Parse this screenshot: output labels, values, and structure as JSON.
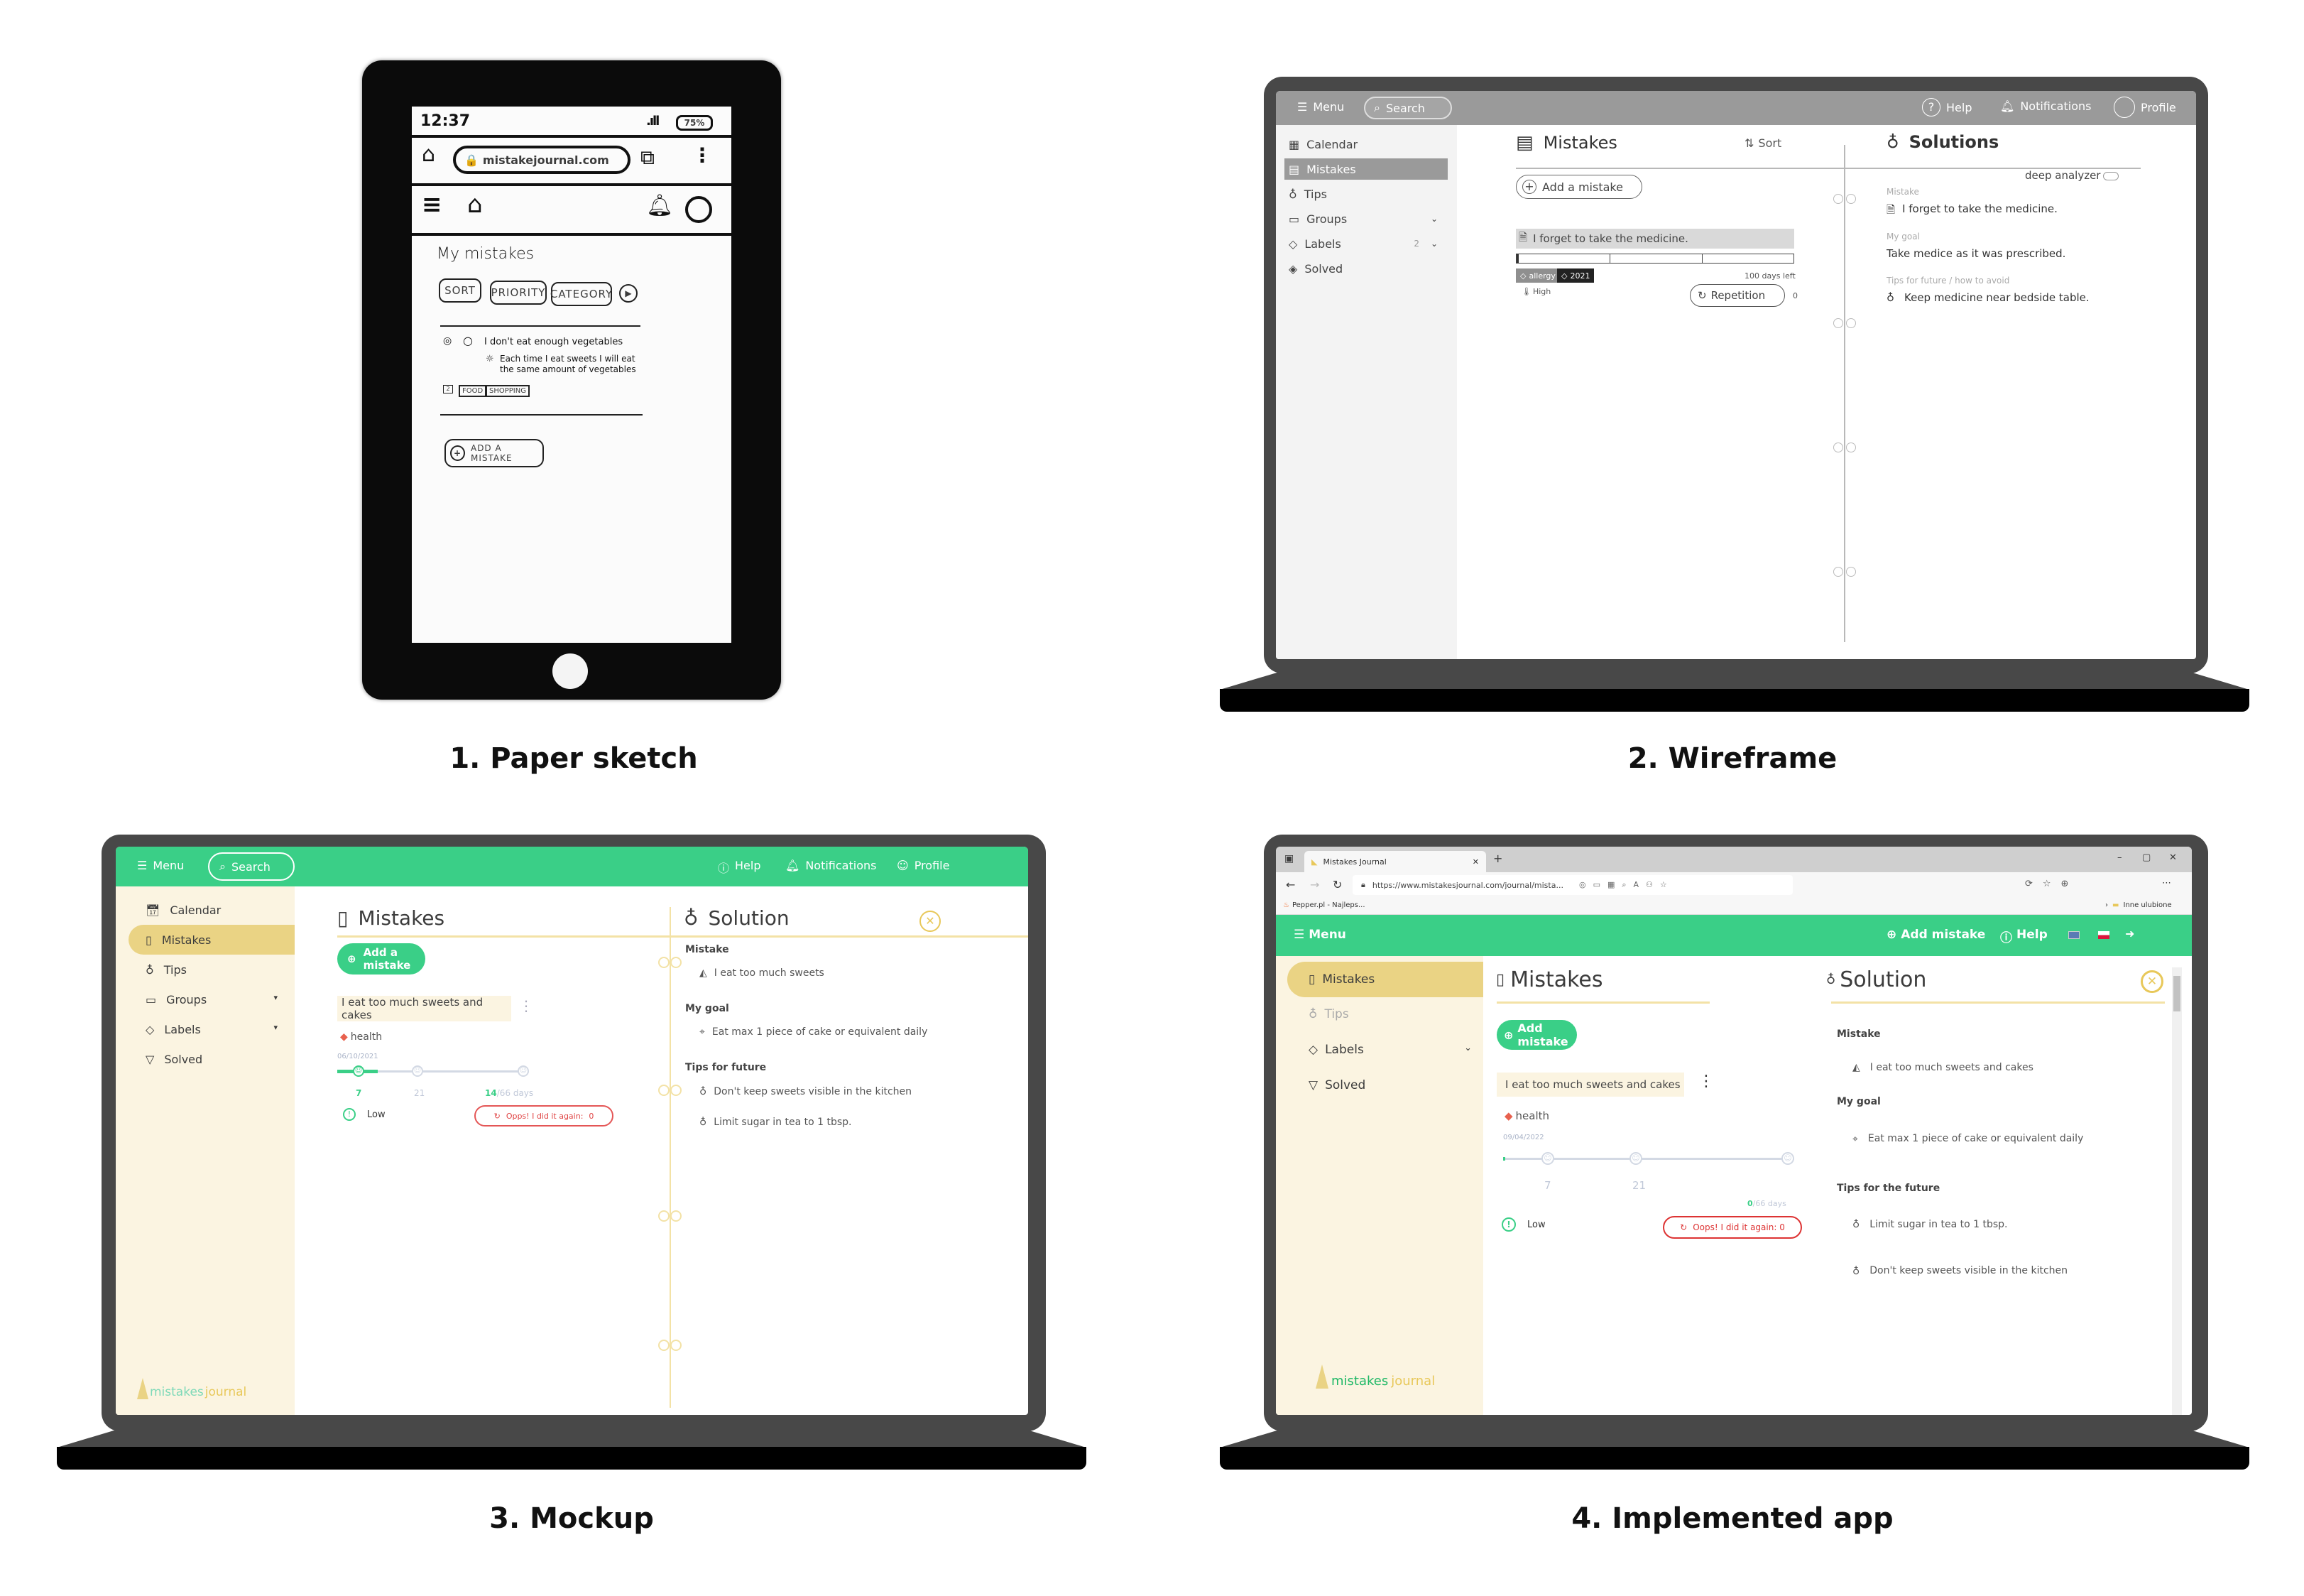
{
  "captions": {
    "sketch": "1. Paper sketch",
    "wireframe": "2. Wireframe",
    "mockup": "3. Mockup",
    "implemented": "4. Implemented app"
  },
  "colors": {
    "brand_green": "#3acf87",
    "cream": "#fbf4e1",
    "gold": "#e8c85a",
    "active_gold": "#ead384",
    "danger_red": "#e45656",
    "wireframe_gray": "#9a9a9a",
    "laptop": "#484848"
  },
  "sketch": {
    "time": "12:37",
    "battery": "75%",
    "url": "mistakejournal.com",
    "heading": "My mistakes",
    "filters": [
      "SORT",
      "PRIORITY",
      "CATEGORY"
    ],
    "mistake": "I don't eat enough vegetables",
    "tip": "Each time I eat sweets I will eat the same amount of vegetables",
    "priority_badge": "2",
    "tags": [
      "FOOD",
      "SHOPPING"
    ],
    "add_button": "ADD A MISTAKE"
  },
  "wireframe": {
    "topbar": {
      "menu": "Menu",
      "search": "Search",
      "help": "Help",
      "notifications": "Notifications",
      "profile": "Profile"
    },
    "sidebar": [
      {
        "label": "Calendar",
        "icon": "calendar-icon",
        "active": false
      },
      {
        "label": "Mistakes",
        "icon": "notebook-icon",
        "active": true
      },
      {
        "label": "Tips",
        "icon": "bulb-icon",
        "active": false
      },
      {
        "label": "Groups",
        "icon": "folder-icon",
        "active": false,
        "chevron": true
      },
      {
        "label": "Labels",
        "icon": "tag-icon",
        "active": false,
        "chevron": true,
        "count": "2"
      },
      {
        "label": "Solved",
        "icon": "diamond-icon",
        "active": false
      }
    ],
    "mistakes": {
      "title": "Mistakes",
      "sort": "Sort",
      "add": "Add a mistake",
      "item": "I forget to take the medicine.",
      "tags": [
        "allergy",
        "2021"
      ],
      "days_left": "100 days left",
      "priority": "High",
      "repetition": "Repetition",
      "repetition_count": "0"
    },
    "solutions": {
      "title": "Solutions",
      "deep_analyzer": "deep analyzer",
      "deep_analyzer_on": false,
      "mistake_label": "Mistake",
      "mistake": "I forget to take the medicine.",
      "goal_label": "My goal",
      "goal": "Take medice as it was prescribed.",
      "tips_label": "Tips for future / how to avoid",
      "tip": "Keep medicine near bedside table."
    }
  },
  "mockup": {
    "topbar": {
      "menu": "Menu",
      "search": "Search",
      "help": "Help",
      "notifications": "Notifications",
      "profile": "Profile"
    },
    "sidebar": [
      {
        "label": "Calendar",
        "icon": "calendar-icon",
        "active": false
      },
      {
        "label": "Mistakes",
        "icon": "notebook-icon",
        "active": true
      },
      {
        "label": "Tips",
        "icon": "bulb-icon",
        "active": false
      },
      {
        "label": "Groups",
        "icon": "folder-icon",
        "active": false,
        "chevron": true
      },
      {
        "label": "Labels",
        "icon": "tag-icon",
        "active": false,
        "chevron": true
      },
      {
        "label": "Solved",
        "icon": "diamond-icon",
        "active": false
      }
    ],
    "logo": {
      "part1": "mistakes",
      "part2": "journal"
    },
    "mistakes": {
      "title": "Mistakes",
      "add": "Add a mistake",
      "item": "I eat too much sweets and cakes",
      "tag": "health",
      "date": "06/10/2021",
      "milestones": [
        "7",
        "21"
      ],
      "progress_days": "14",
      "total_days": "/66 days",
      "progress_fraction": 0.212,
      "priority": "Low",
      "oops": "Opps! I did it again:",
      "oops_count": "0"
    },
    "solution": {
      "title": "Solution",
      "mistake_label": "Mistake",
      "mistake": "I eat too much sweets",
      "goal_label": "My goal",
      "goal": "Eat max 1 piece of cake or equivalent daily",
      "tips_label": "Tips for future",
      "tips": [
        "Don't keep sweets visible in the kitchen",
        "Limit sugar in tea to 1 tbsp."
      ]
    }
  },
  "implemented": {
    "browser": {
      "tab_title": "Mistakes Journal",
      "url": "https://www.mistakesjournal.com/journal/mista...",
      "bookmark": "Pepper.pl - Najleps...",
      "other_favorites": "Inne ulubione"
    },
    "topbar": {
      "menu": "Menu",
      "add": "Add mistake",
      "help": "Help"
    },
    "sidebar": [
      {
        "label": "Mistakes",
        "icon": "notebook-icon",
        "active": true
      },
      {
        "label": "Tips",
        "icon": "bulb-icon",
        "active": false,
        "disabled": true
      },
      {
        "label": "Labels",
        "icon": "tag-icon",
        "active": false,
        "chevron": true
      },
      {
        "label": "Solved",
        "icon": "diamond-icon",
        "active": false
      }
    ],
    "logo": {
      "part1": "mistakes",
      "part2": "journal"
    },
    "mistakes": {
      "title": "Mistakes",
      "add": "Add mistake",
      "item": "I eat too much sweets and cakes",
      "tag": "health",
      "date": "09/04/2022",
      "milestones": [
        "7",
        "21"
      ],
      "progress_days": "0",
      "total_days": "/66 days",
      "progress_fraction": 0.0,
      "priority": "Low",
      "oops": "Oops! I did it again: 0"
    },
    "solution": {
      "title": "Solution",
      "mistake_label": "Mistake",
      "mistake": "I eat too much sweets and cakes",
      "goal_label": "My goal",
      "goal": "Eat max 1 piece of cake or equivalent daily",
      "tips_label": "Tips for the future",
      "tips": [
        "Limit sugar in tea to 1 tbsp.",
        "Don't keep sweets visible in the kitchen"
      ]
    }
  }
}
